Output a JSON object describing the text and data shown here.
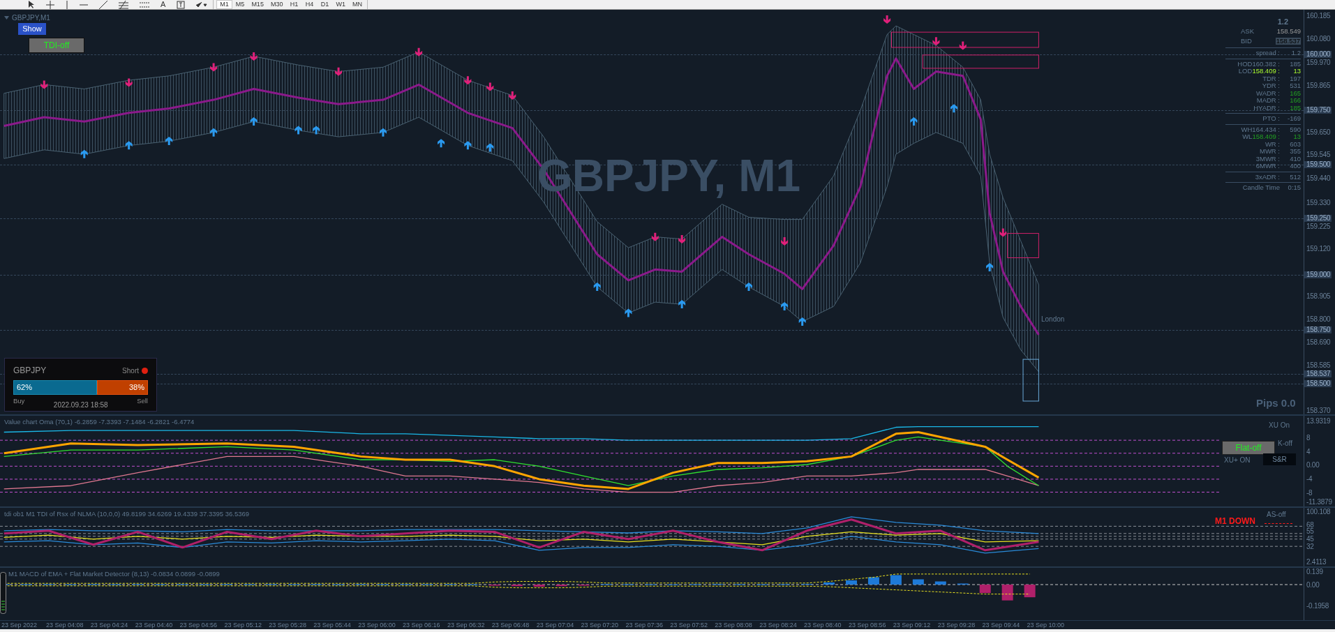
{
  "toolbar": {
    "tools": [
      {
        "kind": "cursor"
      },
      {
        "kind": "crosshair"
      },
      {
        "kind": "vline"
      },
      {
        "kind": "hline"
      },
      {
        "kind": "trendline"
      },
      {
        "kind": "fibo"
      },
      {
        "kind": "channel"
      },
      {
        "kind": "text",
        "label": "A"
      },
      {
        "kind": "label"
      },
      {
        "kind": "arrows"
      }
    ],
    "timeframes": [
      {
        "label": "M1",
        "selected": true
      },
      {
        "label": "M5",
        "selected": false
      },
      {
        "label": "M15",
        "selected": false
      },
      {
        "label": "M30",
        "selected": false
      },
      {
        "label": "H1",
        "selected": false
      },
      {
        "label": "H4",
        "selected": false
      },
      {
        "label": "D1",
        "selected": false
      },
      {
        "label": "W1",
        "selected": false
      },
      {
        "label": "MN",
        "selected": false
      }
    ]
  },
  "chart": {
    "title": "GBPJPY,M1",
    "background_label": "GBPJPY, M1",
    "show_button": "Show",
    "tdi_button": "TDI-off",
    "session_label": "London",
    "pips": "Pips 0.0",
    "info_panel": {
      "header": "1.2",
      "rows": [
        {
          "kind": "ask",
          "label": "ASK",
          "value": "158.549"
        },
        {
          "kind": "bid",
          "label": "BID",
          "value": "158.537"
        },
        {
          "kind": "divider"
        },
        {
          "kind": "stat",
          "label": "spread :",
          "value": "1.2"
        },
        {
          "kind": "divider"
        },
        {
          "kind": "stat",
          "label": "HOD160.382 :",
          "value": "185"
        },
        {
          "kind": "lime",
          "label": "LOD",
          "price": "158.409 :",
          "value": "13"
        },
        {
          "kind": "stat",
          "label": "TDR :",
          "value": "197"
        },
        {
          "kind": "stat",
          "label": "YDR :",
          "value": "531"
        },
        {
          "kind": "green",
          "label": "WADR :",
          "value": "165"
        },
        {
          "kind": "green",
          "label": "MADR :",
          "value": "166"
        },
        {
          "kind": "green",
          "label": "HYADR :",
          "value": "185"
        },
        {
          "kind": "divider"
        },
        {
          "kind": "stat",
          "label": "PTO :",
          "value": "-169"
        },
        {
          "kind": "divider"
        },
        {
          "kind": "stat",
          "label": "WH164.434 :",
          "value": "590"
        },
        {
          "kind": "green",
          "label": "WL",
          "price": "158.409 :",
          "value": "13"
        },
        {
          "kind": "stat",
          "label": "WR :",
          "value": "603"
        },
        {
          "kind": "stat",
          "label": "MWR :",
          "value": "355"
        },
        {
          "kind": "stat",
          "label": "3MWR :",
          "value": "410"
        },
        {
          "kind": "stat",
          "label": "6MWR :",
          "value": "400"
        },
        {
          "kind": "divider"
        },
        {
          "kind": "stat",
          "label": "3xADR :",
          "value": "512"
        },
        {
          "kind": "divider"
        },
        {
          "kind": "stat",
          "label": "Candle Time",
          "value": "0:15"
        }
      ]
    },
    "sentiment": {
      "symbol": "GBPJPY",
      "signal": "Short",
      "buy": {
        "text": "62%",
        "level": 0.62
      },
      "sell": {
        "text": "38%",
        "level": 0.38
      },
      "buy_label": "Buy",
      "sell_label": "Sell",
      "timestamp": "2022.09.23 18:58"
    },
    "price_axis": [
      {
        "label": "160.185",
        "highlighted": false
      },
      {
        "label": "160.080",
        "highlighted": false
      },
      {
        "label": "160.000",
        "highlighted": true
      },
      {
        "label": "159.970",
        "highlighted": false
      },
      {
        "label": "159.865",
        "highlighted": false
      },
      {
        "label": "159.750",
        "highlighted": true
      },
      {
        "label": "159.650",
        "highlighted": false
      },
      {
        "label": "159.545",
        "highlighted": false
      },
      {
        "label": "159.500",
        "highlighted": true
      },
      {
        "label": "159.440",
        "highlighted": false
      },
      {
        "label": "159.330",
        "highlighted": false
      },
      {
        "label": "159.250",
        "highlighted": true
      },
      {
        "label": "159.225",
        "highlighted": false
      },
      {
        "label": "159.120",
        "highlighted": false
      },
      {
        "label": "159.000",
        "highlighted": true
      },
      {
        "label": "158.905",
        "highlighted": false
      },
      {
        "label": "158.800",
        "highlighted": false
      },
      {
        "label": "158.750",
        "highlighted": true
      },
      {
        "label": "158.690",
        "highlighted": false
      },
      {
        "label": "158.585",
        "highlighted": false
      },
      {
        "label": "158.537",
        "highlighted": true
      },
      {
        "label": "158.500",
        "highlighted": true
      },
      {
        "label": "158.370",
        "highlighted": false
      }
    ]
  },
  "panels": [
    {
      "title": "Value chart Oma (70,1) -6.2859 -7.3393 -7.1484 -6.2821 -6.4774",
      "buttons": [
        {
          "label": "XU On",
          "kind": "text"
        },
        {
          "label": "K-off",
          "kind": "text"
        },
        {
          "label": "Flat-off",
          "kind": "grey"
        },
        {
          "label": "XU+ ON",
          "kind": "text"
        },
        {
          "label": "S&R",
          "kind": "dark"
        }
      ],
      "axis": [
        "13.9319",
        "8",
        "4",
        "0.00",
        "-4",
        "-8",
        "-11.3879"
      ]
    },
    {
      "title": "tdi ob1 M1 TDI of Rsx of NLMA (10,0,0) 49.8199 34.6269 19.4339 37.3395 36.5369",
      "signal": "M1 DOWN",
      "buttons": [
        {
          "label": "AS-off",
          "kind": "text"
        }
      ],
      "axis": [
        "100.108",
        "68",
        "55",
        "45",
        "32",
        "2.4113"
      ]
    },
    {
      "title": "M1 MACD of EMA + Flat Market Detector (8,13) -0.0834 0.0899 -0.0899",
      "axis": [
        "0.139",
        "0.00",
        "-0.1958"
      ]
    }
  ],
  "time_axis": [
    "23 Sep 2022",
    "23 Sep 04:08",
    "23 Sep 04:24",
    "23 Sep 04:40",
    "23 Sep 04:56",
    "23 Sep 05:12",
    "23 Sep 05:28",
    "23 Sep 05:44",
    "23 Sep 06:00",
    "23 Sep 06:16",
    "23 Sep 06:32",
    "23 Sep 06:48",
    "23 Sep 07:04",
    "23 Sep 07:20",
    "23 Sep 07:36",
    "23 Sep 07:52",
    "23 Sep 08:08",
    "23 Sep 08:24",
    "23 Sep 08:40",
    "23 Sep 08:56",
    "23 Sep 09:12",
    "23 Sep 09:28",
    "23 Sep 09:44",
    "23 Sep 10:00"
  ]
}
